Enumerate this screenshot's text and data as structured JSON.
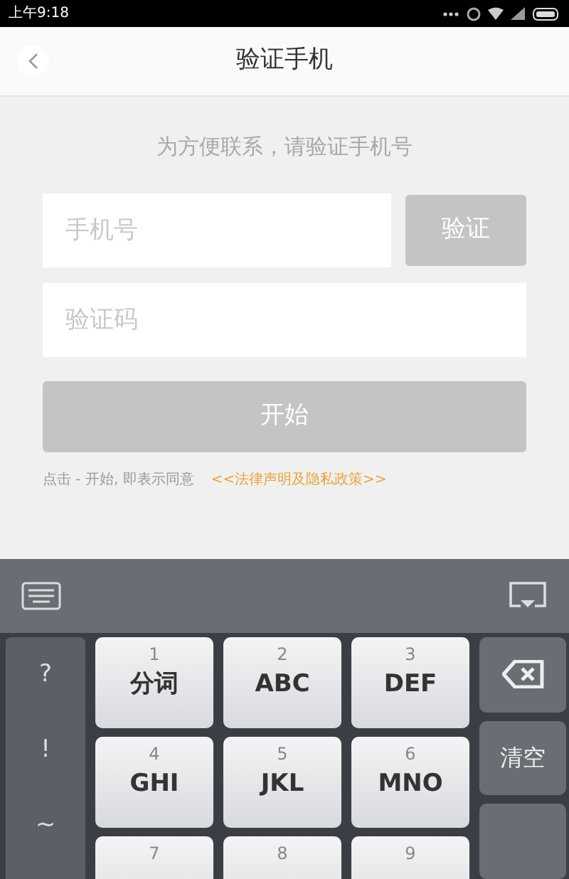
{
  "status_bar": {
    "time": "上午9:18"
  },
  "header": {
    "title": "验证手机"
  },
  "subtitle": "为方便联系，请验证手机号",
  "phone_field": {
    "placeholder": "手机号"
  },
  "verify_button": {
    "label": "验证",
    "disabled": true
  },
  "code_field": {
    "placeholder": "验证码"
  },
  "start_button": {
    "label": "开始",
    "disabled": true
  },
  "agreement": {
    "text": "点击 - 开始, 即表示同意",
    "link": "<<法律声明及隐私政策>>"
  },
  "keyboard": {
    "symbols": [
      "?",
      "!",
      "~"
    ],
    "keys": [
      {
        "number": "1",
        "letters": "分词"
      },
      {
        "number": "2",
        "letters": "ABC"
      },
      {
        "number": "3",
        "letters": "DEF"
      },
      {
        "number": "4",
        "letters": "GHI"
      },
      {
        "number": "5",
        "letters": "JKL"
      },
      {
        "number": "6",
        "letters": "MNO"
      },
      {
        "number": "7"
      },
      {
        "number": "8"
      },
      {
        "number": "9"
      }
    ],
    "side_keys": [
      {
        "kind": "delete"
      },
      {
        "kind": "text",
        "label": "清空"
      },
      {
        "kind": "blank"
      }
    ]
  }
}
